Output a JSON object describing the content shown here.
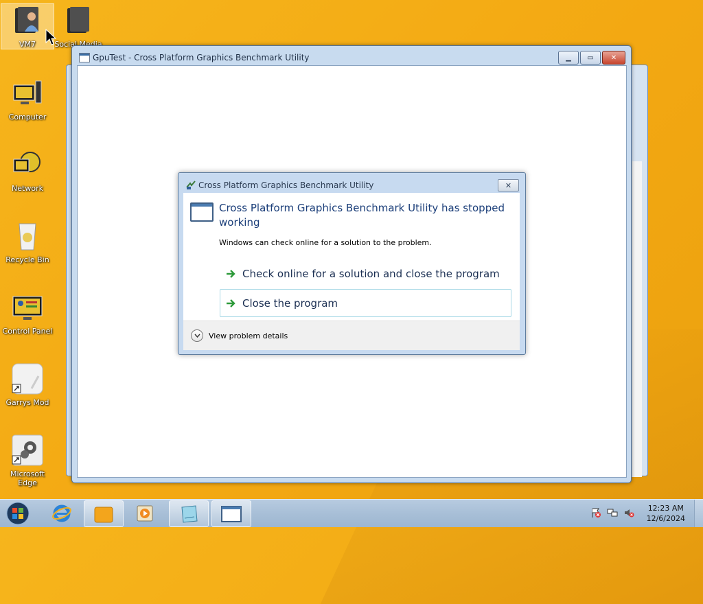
{
  "desktop": {
    "icons": [
      {
        "label": "VM7",
        "icon": "user-folder-icon"
      },
      {
        "label": "Social Media",
        "icon": "folder-icon"
      },
      {
        "label": "Computer",
        "icon": "computer-icon"
      },
      {
        "label": "Network",
        "icon": "network-icon"
      },
      {
        "label": "Recycle Bin",
        "icon": "recycle-bin-icon"
      },
      {
        "label": "Control Panel",
        "icon": "control-panel-icon"
      },
      {
        "label": "Garrys Mod",
        "icon": "garrys-mod-icon"
      },
      {
        "label": "Microsoft Edge",
        "icon": "settings-gear-icon"
      }
    ]
  },
  "app_window": {
    "title": "GpuTest - Cross Platform Graphics Benchmark Utility",
    "buttons": {
      "minimize": "▁",
      "restore": "▭",
      "close": "✕"
    }
  },
  "error_dialog": {
    "title": "Cross Platform Graphics Benchmark Utility",
    "close_label": "✕",
    "heading": "Cross Platform Graphics Benchmark Utility has stopped working",
    "message": "Windows can check online for a solution to the problem.",
    "options": [
      {
        "label": "Check online for a solution and close the program"
      },
      {
        "label": "Close the program"
      }
    ],
    "details_label": "View problem details"
  },
  "taskbar": {
    "clock_time": "12:23 AM",
    "clock_date": "12/6/2024",
    "tray_icons": [
      "action-center-flag-icon",
      "network-icon",
      "volume-muted-icon"
    ]
  },
  "colors": {
    "desktop_background": "#f3a812",
    "window_frame": "#c8dbef",
    "dialog_heading": "#1b3e79",
    "close_button": "#c8452e"
  }
}
